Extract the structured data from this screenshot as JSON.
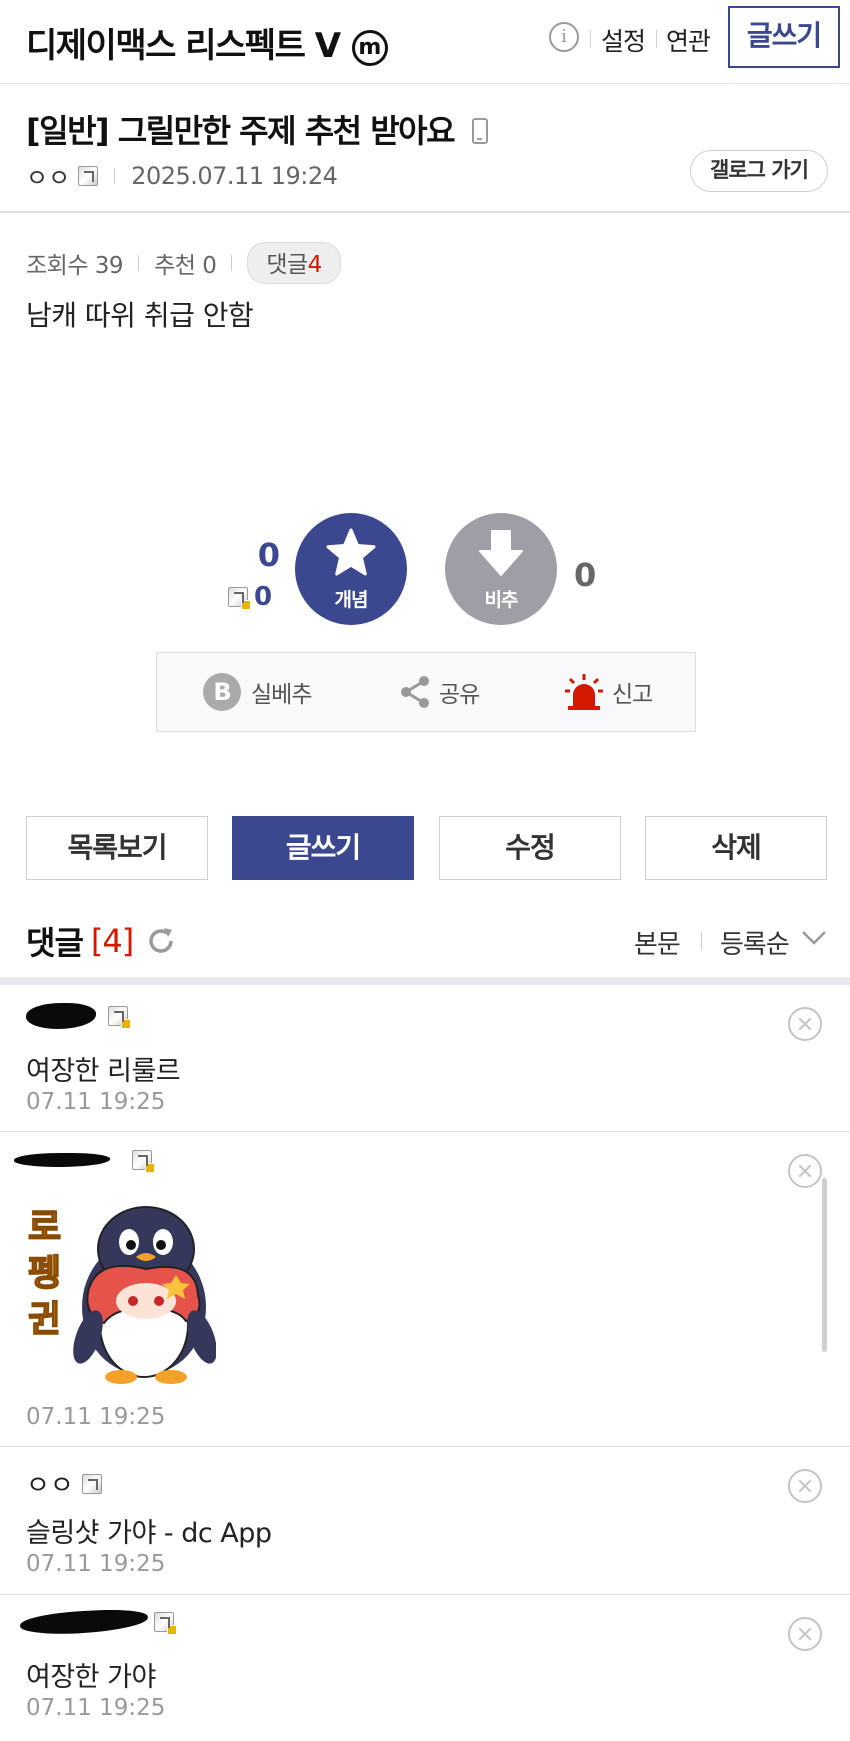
{
  "header": {
    "gallery_title": "디제이맥스 리스펙트 V",
    "gallery_badge": "m",
    "settings_label": "설정",
    "related_label": "연관",
    "write_label": "글쓰기"
  },
  "post": {
    "title": "[일반] 그릴만한 주제 추천 받아요",
    "author": "ㅇㅇ",
    "date": "2025.07.11 19:24",
    "gallog_label": "갤로그 가기",
    "views_label": "조회수 39",
    "recommend_label": "추천 0",
    "comment_pill_label": "댓글",
    "comment_pill_count": "4",
    "body": "남캐 따위 취급 안함"
  },
  "recommend": {
    "up_count": "0",
    "fixed_up_count": "0",
    "up_label": "개념",
    "down_label": "비추",
    "down_count": "0",
    "actions": {
      "silbe_label": "실베추",
      "silbe_icon_letter": "B",
      "share_label": "공유",
      "report_label": "신고"
    }
  },
  "buttons": {
    "list": "목록보기",
    "write": "글쓰기",
    "edit": "수정",
    "delete": "삭제"
  },
  "comments_header": {
    "title": "댓글",
    "count": "[4]",
    "view_body": "본문",
    "sort_label": "등록순"
  },
  "comments": [
    {
      "text": "여장한 리룰르",
      "time": "07.11 19:25"
    },
    {
      "sticker_text": "로펭귄",
      "time": "07.11 19:25"
    },
    {
      "nick": "ㅇㅇ",
      "text": "슬링샷 가야 - dc App",
      "time": "07.11 19:25"
    },
    {
      "text": "여장한 가야",
      "time": "07.11 19:25"
    }
  ],
  "colors": {
    "accent": "#3b4890",
    "count_red": "#d31900",
    "down_gray": "#9e9ea6",
    "report_red": "#d31900"
  },
  "icons": [
    "info-icon",
    "mobile-icon",
    "fixed-nick-icon",
    "star-icon",
    "arrow-down-icon",
    "share-icon",
    "siren-icon",
    "refresh-icon",
    "chevron-down-icon",
    "close-circle-icon"
  ]
}
